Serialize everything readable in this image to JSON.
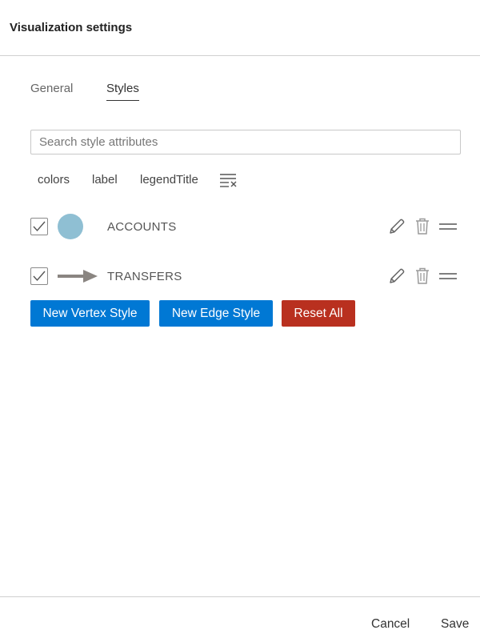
{
  "dialog": {
    "title": "Visualization settings"
  },
  "tabs": [
    {
      "label": "General",
      "active": false
    },
    {
      "label": "Styles",
      "active": true
    }
  ],
  "search": {
    "placeholder": "Search style attributes",
    "value": ""
  },
  "attributes": [
    "colors",
    "label",
    "legendTitle"
  ],
  "clear_icon": "clear-list-icon",
  "styles": [
    {
      "type": "vertex",
      "label": "ACCOUNTS",
      "checked": true,
      "color": "#8fbfd3"
    },
    {
      "type": "edge",
      "label": "TRANSFERS",
      "checked": true,
      "color": "#8a8581"
    }
  ],
  "row_icons": {
    "edit": "pencil-icon",
    "delete": "trash-icon",
    "reorder": "drag-handle-icon"
  },
  "buttons": {
    "new_vertex": "New Vertex Style",
    "new_edge": "New Edge Style",
    "reset_all": "Reset All"
  },
  "footer": {
    "cancel": "Cancel",
    "save": "Save"
  },
  "colors": {
    "primary": "#0078d4",
    "danger": "#b9301f",
    "icon": "#666666",
    "icon_muted": "#9a9a9a"
  }
}
